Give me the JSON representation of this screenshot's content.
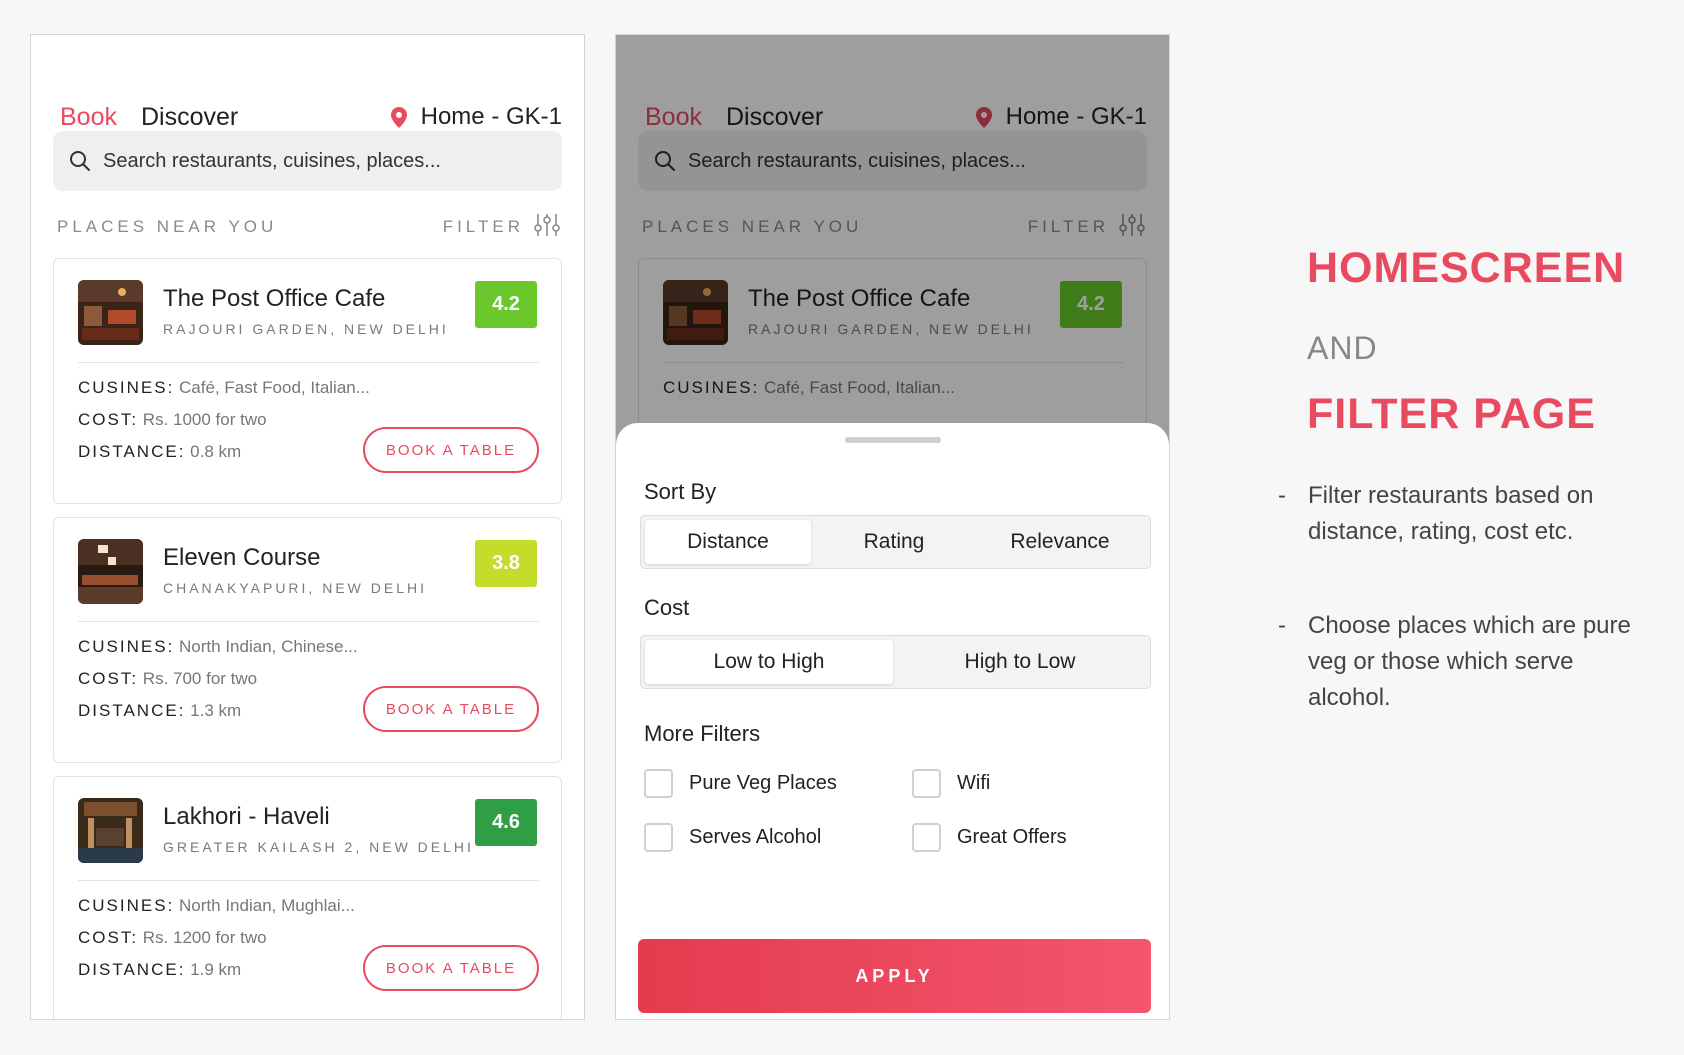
{
  "app": {
    "tabs": {
      "book": "Book",
      "discover": "Discover"
    },
    "location": "Home - GK-1",
    "search_placeholder": "Search restaurants, cuisines, places...",
    "section_label": "PLACES NEAR YOU",
    "filter_label": "FILTER",
    "book_label": "BOOK A TABLE",
    "labels": {
      "cuisines": "CUSINES:",
      "cost": "COST:",
      "distance": "DISTANCE:"
    },
    "restaurants": [
      {
        "name": "The Post Office Cafe",
        "address": "RAJOURI GARDEN, NEW DELHI",
        "rating": "4.2",
        "rating_color": "#6ac82d",
        "cuisines": "Café, Fast Food, Italian...",
        "cost": "Rs. 1000 for two",
        "distance": "0.8 km"
      },
      {
        "name": "Eleven Course",
        "address": "CHANAKYAPURI, NEW DELHI",
        "rating": "3.8",
        "rating_color": "#c3dd2a",
        "cuisines": "North Indian, Chinese...",
        "cost": "Rs. 700 for two",
        "distance": "1.3 km"
      },
      {
        "name": "Lakhori - Haveli",
        "address": "GREATER KAILASH 2, NEW DELHI",
        "rating": "4.6",
        "rating_color": "#2f9e44",
        "cuisines": "North Indian, Mughlai...",
        "cost": "Rs. 1200 for two",
        "distance": "1.9 km"
      }
    ]
  },
  "filter_sheet": {
    "sort_by_title": "Sort By",
    "sort_options": [
      "Distance",
      "Rating",
      "Relevance"
    ],
    "sort_selected": "Distance",
    "cost_title": "Cost",
    "cost_options": [
      "Low to High",
      "High to Low"
    ],
    "cost_selected": "Low to High",
    "more_title": "More Filters",
    "more_options": [
      "Pure Veg Places",
      "Wifi",
      "Serves Alcohol",
      "Great Offers"
    ],
    "apply_label": "APPLY"
  },
  "annotation": {
    "title1": "HOMESCREEN",
    "and": "AND",
    "title2": "FILTER PAGE",
    "bullets": [
      "Filter restaurants based on distance, rating, cost etc.",
      "Choose places which are pure veg or those which serve alcohol."
    ]
  },
  "colors": {
    "accent": "#e84a5f"
  }
}
